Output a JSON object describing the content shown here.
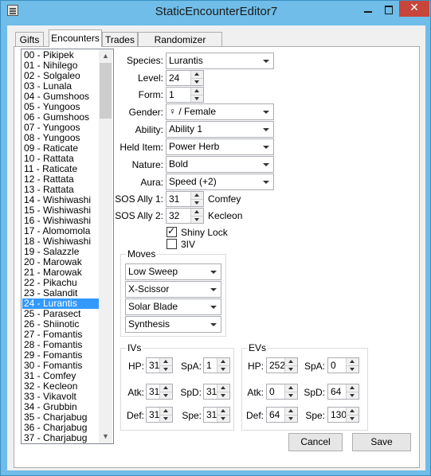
{
  "window": {
    "title": "StaticEncounterEditor7",
    "close_glyph": "✕"
  },
  "tabs": [
    {
      "label": "Gifts"
    },
    {
      "label": "Encounters"
    },
    {
      "label": "Trades"
    },
    {
      "label": "Randomizer Options"
    }
  ],
  "encounter_list": {
    "selected_index": 24,
    "items": [
      "00 - Pikipek",
      "01 - Nihilego",
      "02 - Solgaleo",
      "03 - Lunala",
      "04 - Gumshoos",
      "05 - Yungoos",
      "06 - Gumshoos",
      "07 - Yungoos",
      "08 - Yungoos",
      "09 - Raticate",
      "10 - Rattata",
      "11 - Raticate",
      "12 - Rattata",
      "13 - Rattata",
      "14 - Wishiwashi",
      "15 - Wishiwashi",
      "16 - Wishiwashi",
      "17 - Alomomola",
      "18 - Wishiwashi",
      "19 - Salazzle",
      "20 - Marowak",
      "21 - Marowak",
      "22 - Pikachu",
      "23 - Salandit",
      "24 - Lurantis",
      "25 - Parasect",
      "26 - Shiinotic",
      "27 - Fomantis",
      "28 - Fomantis",
      "29 - Fomantis",
      "30 - Fomantis",
      "31 - Comfey",
      "32 - Kecleon",
      "33 - Vikavolt",
      "34 - Grubbin",
      "35 - Charjabug",
      "36 - Charjabug",
      "37 - Charjabug"
    ]
  },
  "form": {
    "species": {
      "label": "Species:",
      "value": "Lurantis"
    },
    "level": {
      "label": "Level:",
      "value": "24"
    },
    "form": {
      "label": "Form:",
      "value": "1"
    },
    "gender": {
      "label": "Gender:",
      "value": "♀ / Female"
    },
    "ability": {
      "label": "Ability:",
      "value": "Ability 1"
    },
    "held_item": {
      "label": "Held Item:",
      "value": "Power Herb"
    },
    "nature": {
      "label": "Nature:",
      "value": "Bold"
    },
    "aura": {
      "label": "Aura:",
      "value": "Speed (+2)"
    },
    "sos_ally_1": {
      "label": "SOS Ally 1:",
      "value": "31",
      "name": "Comfey"
    },
    "sos_ally_2": {
      "label": "SOS Ally 2:",
      "value": "32",
      "name": "Kecleon"
    },
    "shiny_lock": {
      "label": "Shiny Lock",
      "checked": true
    },
    "three_iv": {
      "label": "3IV",
      "checked": false
    }
  },
  "moves": {
    "title": "Moves",
    "items": [
      "Low Sweep",
      "X-Scissor",
      "Solar Blade",
      "Synthesis"
    ]
  },
  "ivs": {
    "title": "IVs",
    "hp": {
      "label": "HP:",
      "value": "31"
    },
    "atk": {
      "label": "Atk:",
      "value": "31"
    },
    "def": {
      "label": "Def:",
      "value": "31"
    },
    "spa": {
      "label": "SpA:",
      "value": "1"
    },
    "spd": {
      "label": "SpD:",
      "value": "31"
    },
    "spe": {
      "label": "Spe:",
      "value": "31"
    }
  },
  "evs": {
    "title": "EVs",
    "hp": {
      "label": "HP:",
      "value": "252"
    },
    "atk": {
      "label": "Atk:",
      "value": "0"
    },
    "def": {
      "label": "Def:",
      "value": "64"
    },
    "spa": {
      "label": "SpA:",
      "value": "0"
    },
    "spd": {
      "label": "SpD:",
      "value": "64"
    },
    "spe": {
      "label": "Spe:",
      "value": "130"
    }
  },
  "buttons": {
    "cancel": "Cancel",
    "save": "Save"
  },
  "colors": {
    "selection": "#3399ff",
    "title_bar": "#6fbde8",
    "close": "#c7453a"
  }
}
